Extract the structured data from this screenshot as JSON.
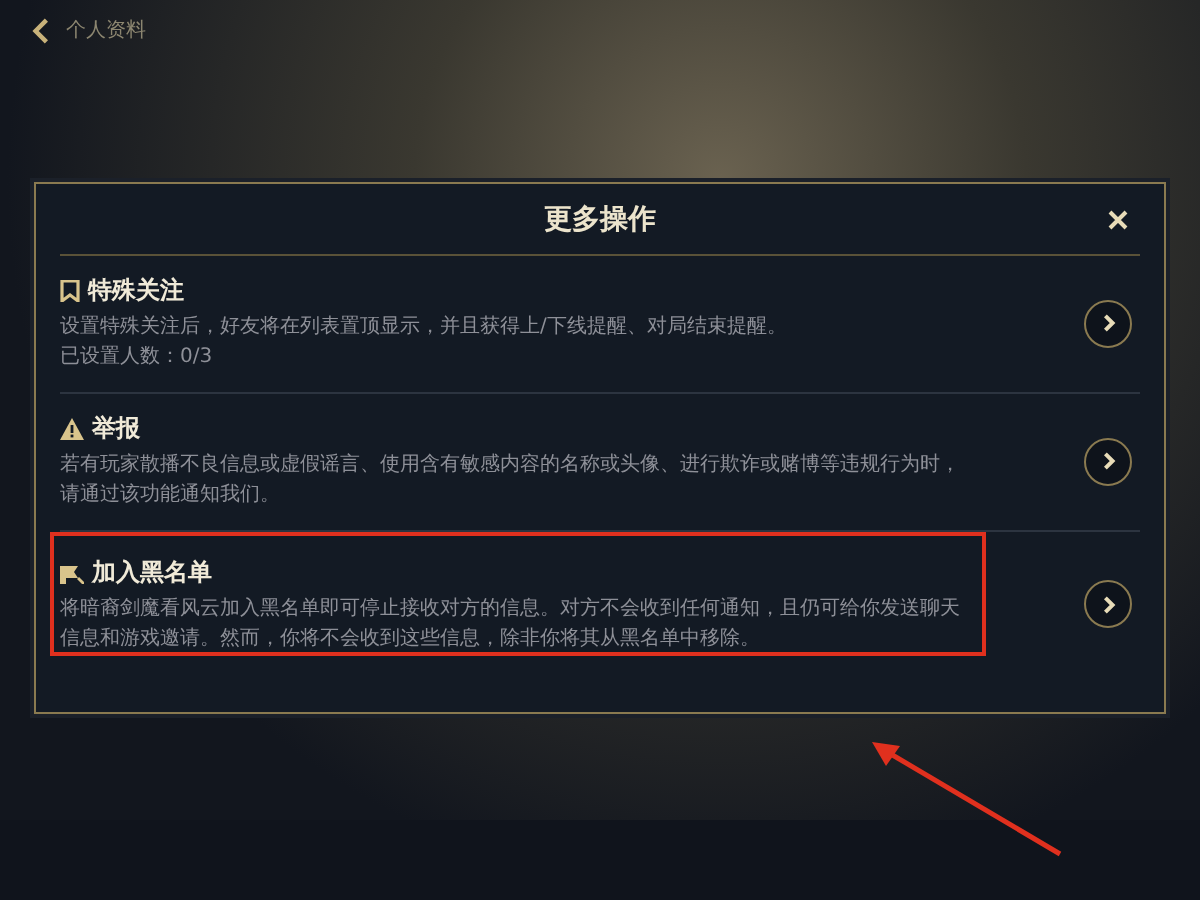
{
  "top_bar": {
    "title": "个人资料"
  },
  "dialog": {
    "title": "更多操作",
    "options": [
      {
        "kind": "bookmark",
        "title": "特殊关注",
        "description": "设置特殊关注后，好友将在列表置顶显示，并且获得上/下线提醒、对局结束提醒。",
        "note": "已设置人数：0/3"
      },
      {
        "kind": "warning",
        "title": "举报",
        "description": "若有玩家散播不良信息或虚假谣言、使用含有敏感内容的名称或头像、进行欺诈或赌博等违规行为时，请通过该功能通知我们。"
      },
      {
        "kind": "block",
        "title": "加入黑名单",
        "description": "将暗裔剑魔看风云加入黑名单即可停止接收对方的信息。对方不会收到任何通知，且仍可给你发送聊天信息和游戏邀请。然而，你将不会收到这些信息，除非你将其从黑名单中移除。"
      }
    ]
  }
}
